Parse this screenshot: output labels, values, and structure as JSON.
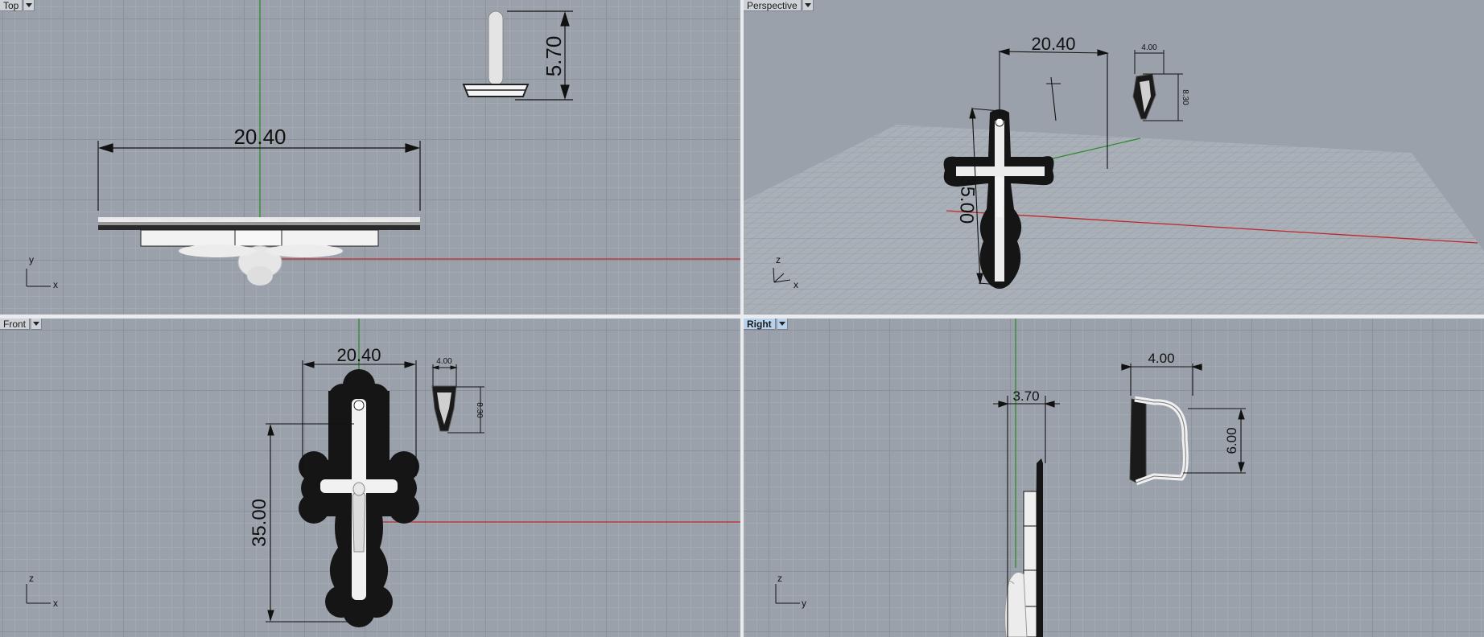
{
  "viewports": {
    "top": {
      "label": "Top",
      "axes": {
        "h": "x",
        "v": "y"
      }
    },
    "perspective": {
      "label": "Perspective",
      "axes": {
        "h": "x",
        "v": "z"
      }
    },
    "front": {
      "label": "Front",
      "axes": {
        "h": "x",
        "v": "z"
      }
    },
    "right": {
      "label": "Right",
      "axes": {
        "h": "y",
        "v": "z"
      }
    }
  },
  "dimensions": {
    "top": {
      "width": "20.40",
      "bail_height": "5.70"
    },
    "perspective": {
      "width": "20.40",
      "height": "35.00",
      "bail_width": "4.00",
      "bail_height": "8.30"
    },
    "front": {
      "width": "20.40",
      "height": "35.00",
      "bail_width": "4.00",
      "bail_height": "8.30"
    },
    "right": {
      "thickness": "3.70",
      "bail_depth": "4.00",
      "bail_height": "6.00"
    }
  },
  "colors": {
    "background": "#9ba1aa",
    "x_axis": "#c0272d",
    "y_axis": "#2e8b2e",
    "active_label": "#b9d2ec"
  }
}
